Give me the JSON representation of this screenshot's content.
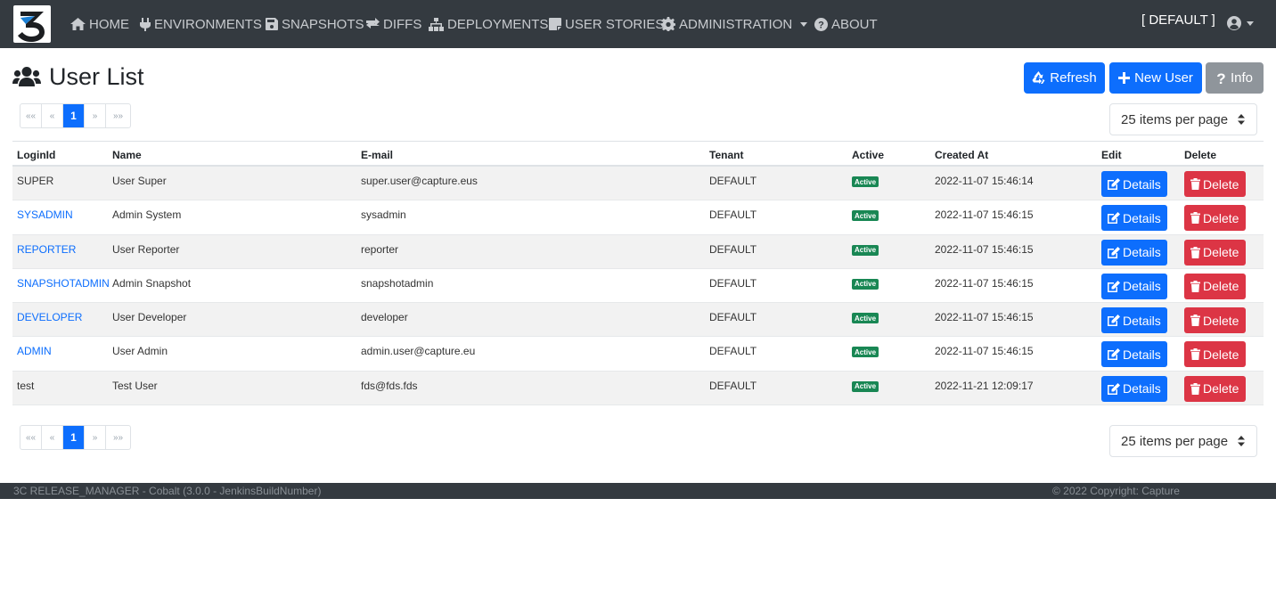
{
  "nav": {
    "items": [
      {
        "label": "HOME",
        "icon": "home-icon"
      },
      {
        "label": "ENVIRONMENTS",
        "icon": "plug-icon"
      },
      {
        "label": "SNAPSHOTS",
        "icon": "floppy-icon"
      },
      {
        "label": "DIFFS",
        "icon": "arrows-exchange-icon"
      },
      {
        "label": "DEPLOYMENTS",
        "icon": "sitemap-icon"
      },
      {
        "label": "USER STORIES",
        "icon": "sticky-note-icon"
      },
      {
        "label": "ADMINISTRATION",
        "icon": "gear-icon"
      },
      {
        "label": "ABOUT",
        "icon": "question-circle-icon"
      }
    ],
    "tenant": "[ DEFAULT ]",
    "colors": {
      "navbar": "#343a40",
      "primary": "#0d6efd",
      "danger": "#dc3545",
      "success": "#198754"
    }
  },
  "page": {
    "title": "User List",
    "refresh_label": "Refresh",
    "new_user_label": "New User",
    "info_label": "Info"
  },
  "pagination": {
    "first": "««",
    "prev": "«",
    "current": "1",
    "next": "»",
    "last": "»»",
    "items_per_page": "25 items per page"
  },
  "table": {
    "headers": [
      "LoginId",
      "Name",
      "E-mail",
      "Tenant",
      "Active",
      "Created At",
      "Edit",
      "Delete"
    ],
    "rows": [
      {
        "login": "SUPER",
        "name": "User Super",
        "email": "super.user@capture.eus",
        "tenant": "DEFAULT",
        "active": "Active",
        "created": "2022-11-07 15:46:14",
        "details": "Details",
        "delete": "Delete"
      },
      {
        "login": "SYSADMIN",
        "name": "Admin System",
        "email": "sysadmin",
        "tenant": "DEFAULT",
        "active": "Active",
        "created": "2022-11-07 15:46:15",
        "details": "Details",
        "delete": "Delete"
      },
      {
        "login": "REPORTER",
        "name": "User Reporter",
        "email": "reporter",
        "tenant": "DEFAULT",
        "active": "Active",
        "created": "2022-11-07 15:46:15",
        "details": "Details",
        "delete": "Delete"
      },
      {
        "login": "SNAPSHOTADMIN",
        "name": "Admin Snapshot",
        "email": "snapshotadmin",
        "tenant": "DEFAULT",
        "active": "Active",
        "created": "2022-11-07 15:46:15",
        "details": "Details",
        "delete": "Delete"
      },
      {
        "login": "DEVELOPER",
        "name": "User Developer",
        "email": "developer",
        "tenant": "DEFAULT",
        "active": "Active",
        "created": "2022-11-07 15:46:15",
        "details": "Details",
        "delete": "Delete"
      },
      {
        "login": "ADMIN",
        "name": "User Admin",
        "email": "admin.user@capture.eu",
        "tenant": "DEFAULT",
        "active": "Active",
        "created": "2022-11-07 15:46:15",
        "details": "Details",
        "delete": "Delete"
      },
      {
        "login": "test",
        "name": "Test User",
        "email": "fds@fds.fds",
        "tenant": "DEFAULT",
        "active": "Active",
        "created": "2022-11-21 12:09:17",
        "details": "Details",
        "delete": "Delete"
      }
    ]
  },
  "footer": {
    "left": "3C RELEASE_MANAGER - Cobalt (3.0.0 - JenkinsBuildNumber)",
    "right": "© 2022 Copyright: Capture"
  }
}
